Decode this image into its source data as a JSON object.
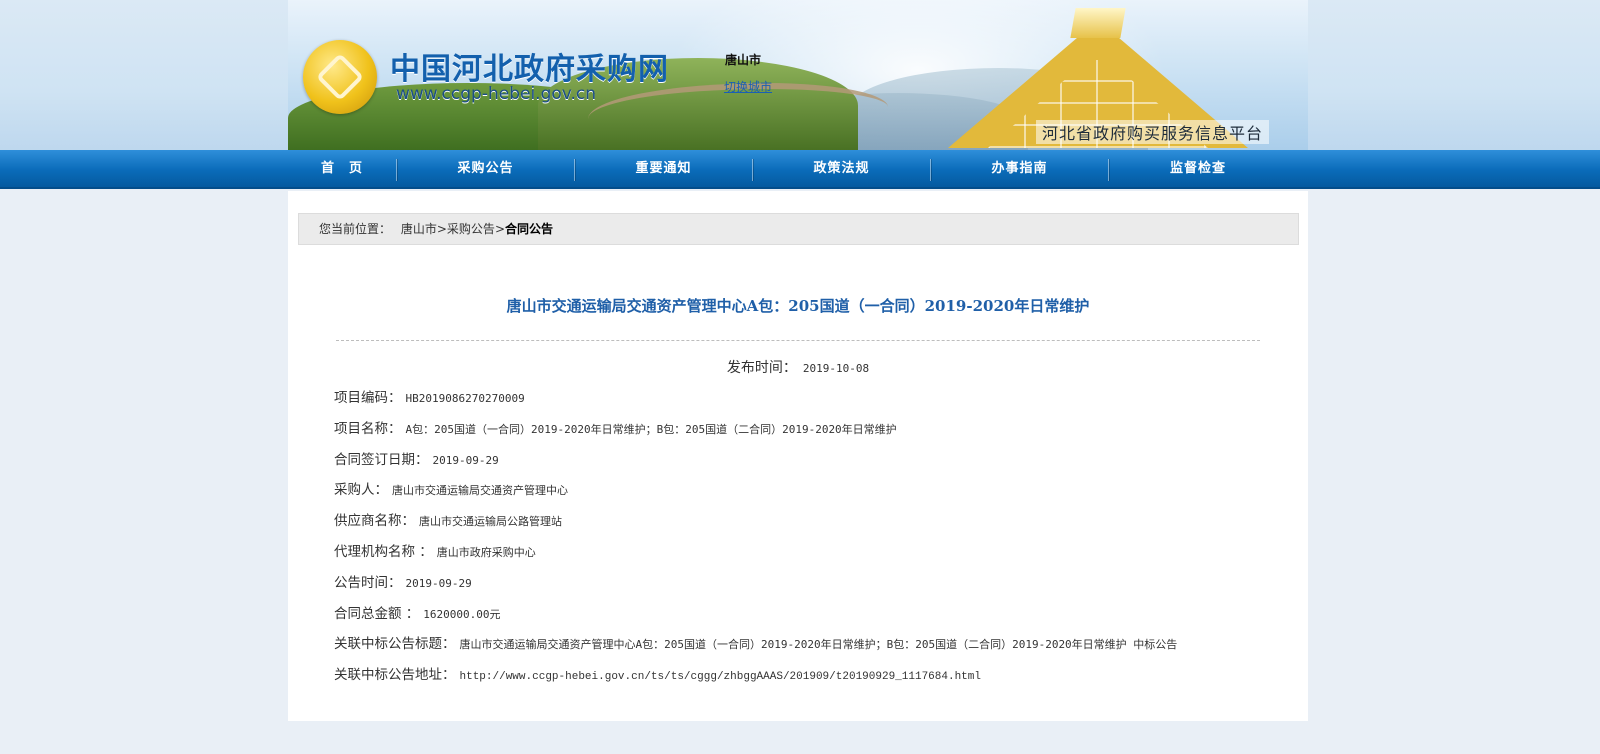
{
  "header": {
    "site_title": "中国河北政府采购网",
    "site_url": "www.ccgp-hebei.gov.cn",
    "city": "唐山市",
    "switch_city": "切换城市",
    "slogan": "河北省政府购买服务信息平台"
  },
  "nav": {
    "items": [
      {
        "label": "首　页"
      },
      {
        "label": "采购公告"
      },
      {
        "label": "重要通知"
      },
      {
        "label": "政策法规"
      },
      {
        "label": "办事指南"
      },
      {
        "label": "监督检查"
      }
    ]
  },
  "breadcrumb": {
    "prefix": "您当前位置：",
    "items": [
      "唐山市",
      "采购公告",
      "合同公告"
    ],
    "sep": ">"
  },
  "article": {
    "title": "唐山市交通运输局交通资产管理中心A包：205国道（一合同）2019-2020年日常维护",
    "pub_label": "发布时间：",
    "pub_value": "2019-10-08",
    "fields": [
      {
        "label": "项目编码：",
        "value": "HB2019086270270009"
      },
      {
        "label": "项目名称：",
        "value": "A包：205国道（一合同）2019-2020年日常维护；B包：205国道（二合同）2019-2020年日常维护"
      },
      {
        "label": "合同签订日期：",
        "value": "2019-09-29"
      },
      {
        "label": "采购人：",
        "value": "唐山市交通运输局交通资产管理中心"
      },
      {
        "label": "供应商名称：",
        "value": "唐山市交通运输局公路管理站"
      },
      {
        "label": "代理机构名称 ：",
        "value": "唐山市政府采购中心"
      },
      {
        "label": "公告时间：",
        "value": "2019-09-29"
      },
      {
        "label": "合同总金额 ：",
        "value": "1620000.00元"
      },
      {
        "label": "关联中标公告标题：",
        "value": "唐山市交通运输局交通资产管理中心A包：205国道（一合同）2019-2020年日常维护；B包：205国道（二合同）2019-2020年日常维护 中标公告"
      },
      {
        "label": "关联中标公告地址：",
        "value": "http://www.ccgp-hebei.gov.cn/ts/ts/cggg/zhbggAAAS/201909/t20190929_1117684.html"
      }
    ]
  }
}
